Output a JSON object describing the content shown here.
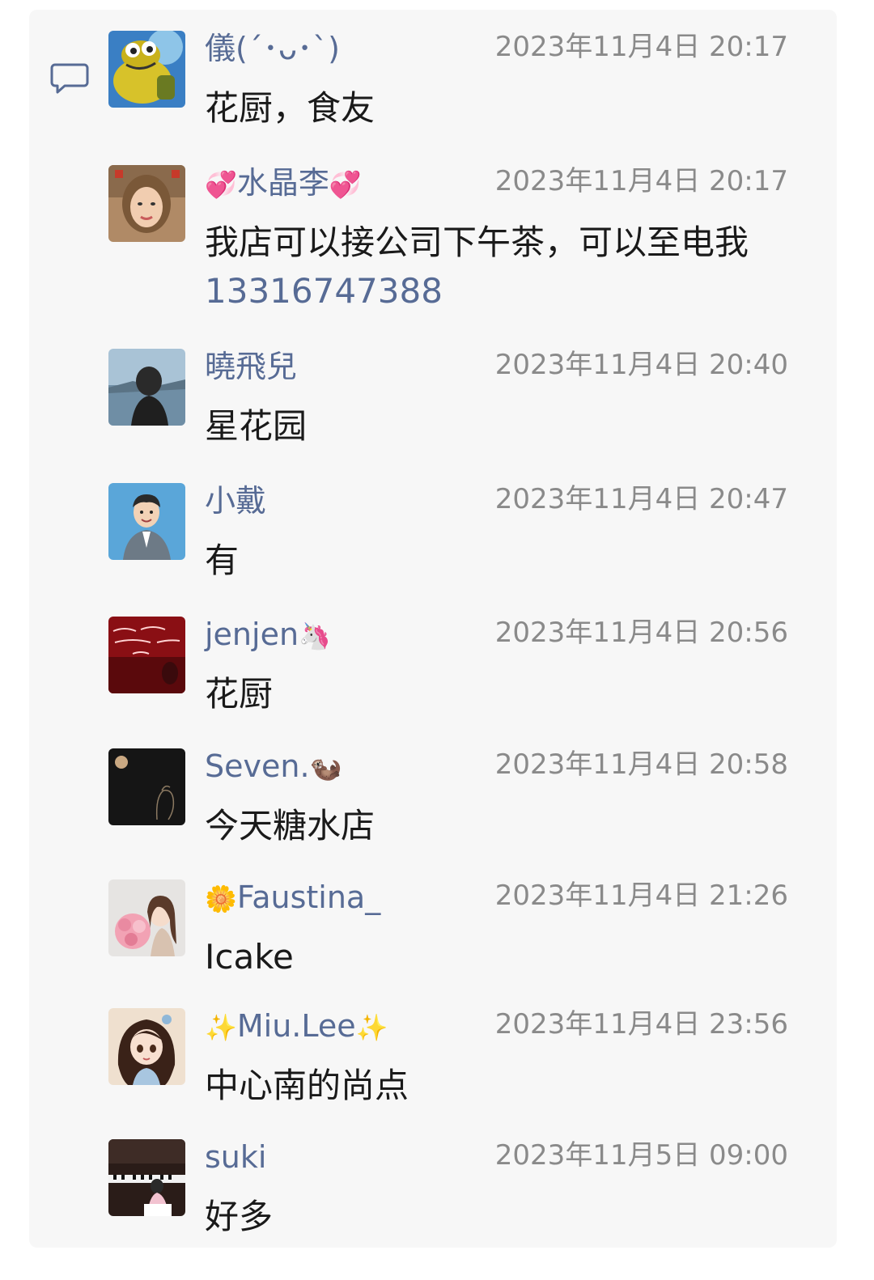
{
  "comments": [
    {
      "name": "儀(´･ᴗ･`)",
      "name_prefix": "",
      "name_suffix": "",
      "time": "2023年11月4日 20:17",
      "message": "花厨，食友",
      "avatar": "frog-avatar"
    },
    {
      "name": "水晶李",
      "name_prefix": "💞",
      "name_suffix": "💞",
      "time": "2023年11月4日 20:17",
      "message": "我店可以接公司下午茶，可以至电我",
      "phone": "13316747388",
      "avatar": "woman-portrait-avatar"
    },
    {
      "name": "曉飛兒",
      "name_prefix": "",
      "name_suffix": "",
      "time": "2023年11月4日 20:40",
      "message": "星花园",
      "avatar": "lake-silhouette-avatar"
    },
    {
      "name": "小戴",
      "name_prefix": "",
      "name_suffix": "",
      "time": "2023年11月4日 20:47",
      "message": "有",
      "avatar": "cartoon-man-avatar"
    },
    {
      "name": "jenjen",
      "name_prefix": "",
      "name_suffix": "🦄",
      "time": "2023年11月4日 20:56",
      "message": "花厨",
      "avatar": "red-neon-avatar"
    },
    {
      "name": "Seven.",
      "name_prefix": "",
      "name_suffix": "🦦",
      "time": "2023年11月4日 20:58",
      "message": "今天糖水店",
      "avatar": "dark-moon-avatar"
    },
    {
      "name": "Faustina_",
      "name_prefix": "🌼",
      "name_suffix": "",
      "time": "2023年11月4日 21:26",
      "message": "Icake",
      "avatar": "flower-girl-avatar"
    },
    {
      "name": "Miu.Lee",
      "name_prefix": "✨",
      "name_suffix": "✨",
      "time": "2023年11月4日 23:56",
      "message": "中心南的尚点",
      "avatar": "anime-girl-avatar"
    },
    {
      "name": "suki",
      "name_prefix": "",
      "name_suffix": "",
      "time": "2023年11月5日 09:00",
      "message": "好多",
      "avatar": "piano-avatar"
    }
  ],
  "colors": {
    "name": "#576b95",
    "time": "#8a8a8a",
    "message": "#1a1a1a",
    "panel": "#f7f7f7"
  },
  "icons": {
    "comment": "comment-bubble-icon"
  }
}
